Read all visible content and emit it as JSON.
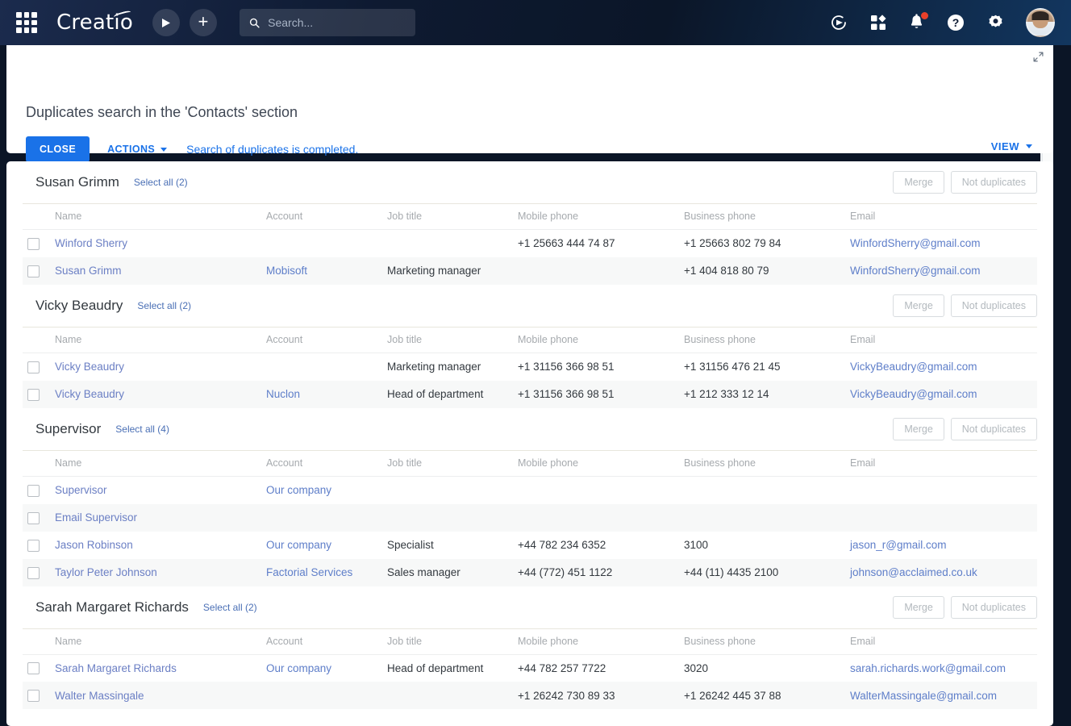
{
  "topnav": {
    "brand": "Creatio",
    "apps_icon": "apps-grid-icon",
    "play_icon": "play-icon",
    "add_icon": "plus-icon",
    "search": {
      "value": "",
      "placeholder": "Search..."
    },
    "right_icons": [
      {
        "name": "copilot-icon"
      },
      {
        "name": "apps-squares-icon"
      },
      {
        "name": "notifications-bell-icon",
        "badge": true
      },
      {
        "name": "help-question-icon"
      },
      {
        "name": "settings-gear-icon"
      }
    ],
    "avatar": "user-avatar"
  },
  "toolbar": {
    "title": "Duplicates search in the 'Contacts' section",
    "close_label": "CLOSE",
    "actions_label": "ACTIONS",
    "status_message": "Search of duplicates is completed.",
    "view_label": "VIEW",
    "expand_icon": "expand-icon"
  },
  "columns": [
    "Name",
    "Account",
    "Job title",
    "Mobile phone",
    "Business phone",
    "Email"
  ],
  "group_buttons": {
    "merge": "Merge",
    "not_duplicates": "Not duplicates"
  },
  "groups": [
    {
      "title": "Susan Grimm",
      "select_all": "Select all (2)",
      "rows": [
        {
          "name": "Winford Sherry",
          "account": "",
          "job": "",
          "mobile": "+1 25663 444 74 87",
          "business": "+1 25663 802 79 84",
          "email": "WinfordSherry@gmail.com"
        },
        {
          "name": "Susan Grimm",
          "account": "Mobisoft",
          "job": "Marketing manager",
          "mobile": "",
          "business": "+1 404 818 80 79",
          "email": "WinfordSherry@gmail.com"
        }
      ]
    },
    {
      "title": "Vicky Beaudry",
      "select_all": "Select all (2)",
      "rows": [
        {
          "name": "Vicky Beaudry",
          "account": "",
          "job": "Marketing manager",
          "mobile": "+1 31156 366 98 51",
          "business": "+1 31156 476 21 45",
          "email": "VickyBeaudry@gmail.com"
        },
        {
          "name": "Vicky Beaudry",
          "account": "Nuclon",
          "job": "Head of department",
          "mobile": "+1 31156 366 98 51",
          "business": "+1 212 333 12 14",
          "email": "VickyBeaudry@gmail.com"
        }
      ]
    },
    {
      "title": "Supervisor",
      "select_all": "Select all (4)",
      "rows": [
        {
          "name": "Supervisor",
          "account": "Our company",
          "job": "",
          "mobile": "",
          "business": "",
          "email": ""
        },
        {
          "name": "Email Supervisor",
          "account": "",
          "job": "",
          "mobile": "",
          "business": "",
          "email": ""
        },
        {
          "name": "Jason Robinson",
          "account": "Our company",
          "job": "Specialist",
          "mobile": "+44 782 234 6352",
          "business": "3100",
          "email": "jason_r@gmail.com"
        },
        {
          "name": "Taylor Peter Johnson",
          "account": "Factorial Services",
          "job": "Sales manager",
          "mobile": "+44 (772) 451 1122",
          "business": "+44 (11) 4435 2100",
          "email": "johnson@acclaimed.co.uk"
        }
      ]
    },
    {
      "title": "Sarah Margaret Richards",
      "select_all": "Select all (2)",
      "rows": [
        {
          "name": "Sarah Margaret Richards",
          "account": "Our company",
          "job": "Head of department",
          "mobile": "+44 782 257 7722",
          "business": "3020",
          "email": "sarah.richards.work@gmail.com"
        },
        {
          "name": "Walter Massingale",
          "account": "",
          "job": "",
          "mobile": "+1 26242 730 89 33",
          "business": "+1 26242 445 37 88",
          "email": "WalterMassingale@gmail.com"
        }
      ]
    }
  ],
  "colors": {
    "accent": "#1a72e8",
    "link": "#5e7ec9",
    "header_dark": "#0b1628",
    "badge_red": "#e8402a"
  }
}
